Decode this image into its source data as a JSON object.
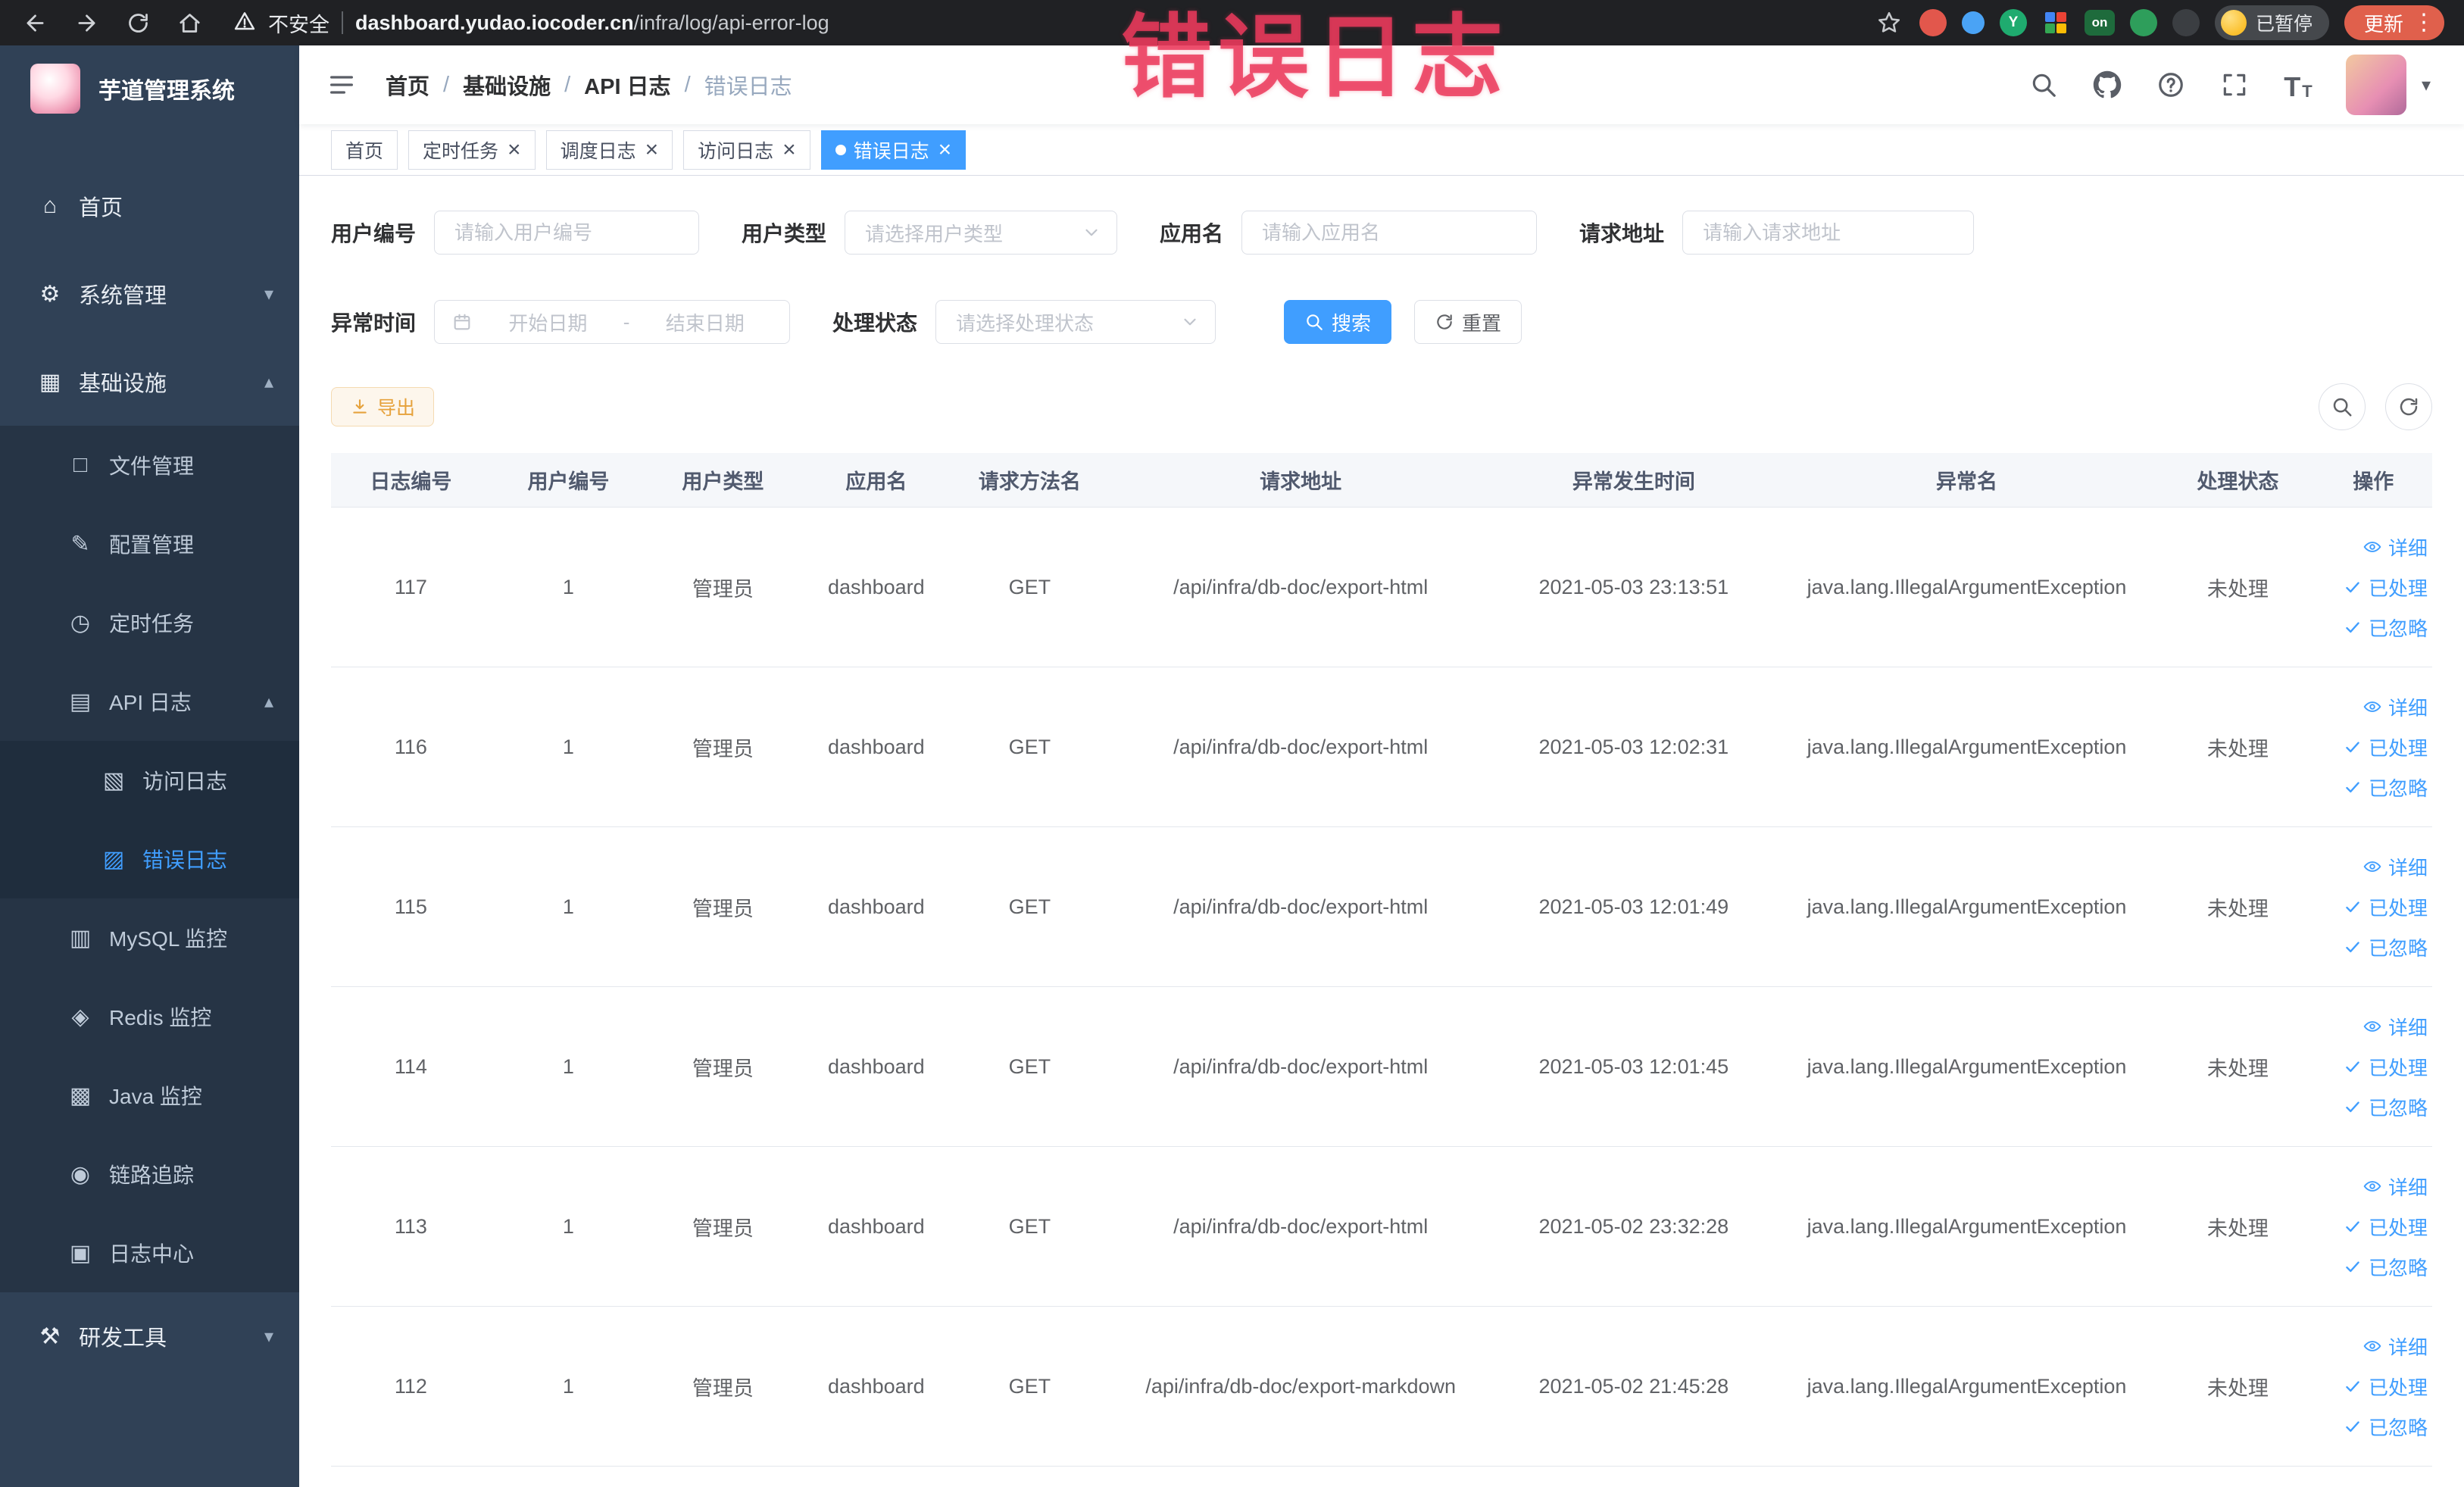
{
  "annotation": {
    "text": "错误日志"
  },
  "browser": {
    "security_label": "不安全",
    "url_host": "dashboard.yudao.iocoder.cn",
    "url_path": "/infra/log/api-error-log",
    "paused_badge": "已暂停",
    "update_button": "更新",
    "extension_on_badge": "on",
    "extension_y_badge": "Y"
  },
  "sidebar": {
    "logo_title": "芋道管理系统",
    "items": [
      {
        "name": "home",
        "label": "首页",
        "icon": "home-icon",
        "level": 0
      },
      {
        "name": "system-management",
        "label": "系统管理",
        "icon": "gear-icon",
        "level": 0,
        "arrow": "down"
      },
      {
        "name": "infrastructure",
        "label": "基础设施",
        "icon": "infra-icon",
        "level": 0,
        "arrow": "up"
      },
      {
        "name": "file-management",
        "label": "文件管理",
        "icon": "file-icon",
        "level": 1
      },
      {
        "name": "config-management",
        "label": "配置管理",
        "icon": "config-icon",
        "level": 1
      },
      {
        "name": "scheduled-tasks",
        "label": "定时任务",
        "icon": "schedule-icon",
        "level": 1
      },
      {
        "name": "api-log",
        "label": "API 日志",
        "icon": "api-log-icon",
        "level": 1,
        "arrow": "up"
      },
      {
        "name": "access-log",
        "label": "访问日志",
        "icon": "access-log-icon",
        "level": 2
      },
      {
        "name": "error-log",
        "label": "错误日志",
        "icon": "error-log-icon",
        "level": 2,
        "active": true
      },
      {
        "name": "mysql-monitor",
        "label": "MySQL 监控",
        "icon": "mysql-icon",
        "level": 1
      },
      {
        "name": "redis-monitor",
        "label": "Redis 监控",
        "icon": "redis-icon",
        "level": 1
      },
      {
        "name": "java-monitor",
        "label": "Java 监控",
        "icon": "java-icon",
        "level": 1
      },
      {
        "name": "trace",
        "label": "链路追踪",
        "icon": "trace-icon",
        "level": 1
      },
      {
        "name": "log-center",
        "label": "日志中心",
        "icon": "log-center-icon",
        "level": 1
      },
      {
        "name": "dev-tools",
        "label": "研发工具",
        "icon": "tools-icon",
        "level": 0,
        "arrow": "down"
      }
    ]
  },
  "navbar": {
    "breadcrumb": [
      "首页",
      "基础设施",
      "API 日志",
      "错误日志"
    ]
  },
  "tabs": [
    {
      "name": "home",
      "label": "首页",
      "closable": false,
      "active": false
    },
    {
      "name": "scheduled-tasks",
      "label": "定时任务",
      "closable": true,
      "active": false
    },
    {
      "name": "schedule-log",
      "label": "调度日志",
      "closable": true,
      "active": false
    },
    {
      "name": "access-log",
      "label": "访问日志",
      "closable": true,
      "active": false
    },
    {
      "name": "error-log",
      "label": "错误日志",
      "closable": true,
      "active": true
    }
  ],
  "filters": {
    "user_id_label": "用户编号",
    "user_id_placeholder": "请输入用户编号",
    "user_type_label": "用户类型",
    "user_type_placeholder": "请选择用户类型",
    "app_name_label": "应用名",
    "app_name_placeholder": "请输入应用名",
    "request_url_label": "请求地址",
    "request_url_placeholder": "请输入请求地址",
    "exception_time_label": "异常时间",
    "date_start_placeholder": "开始日期",
    "date_separator": "-",
    "date_end_placeholder": "结束日期",
    "process_status_label": "处理状态",
    "process_status_placeholder": "请选择处理状态",
    "search_button": "搜索",
    "reset_button": "重置"
  },
  "toolbar": {
    "export_button": "导出"
  },
  "table": {
    "columns": [
      "日志编号",
      "用户编号",
      "用户类型",
      "应用名",
      "请求方法名",
      "请求地址",
      "异常发生时间",
      "异常名",
      "处理状态",
      "操作"
    ],
    "actions": [
      "详细",
      "已处理",
      "已忽略"
    ],
    "rows": [
      {
        "id": "117",
        "user_id": "1",
        "user_type": "管理员",
        "app": "dashboard",
        "method": "GET",
        "url": "/api/infra/db-doc/export-html",
        "time": "2021-05-03 23:13:51",
        "exception": "java.lang.IllegalArgumentException",
        "status": "未处理"
      },
      {
        "id": "116",
        "user_id": "1",
        "user_type": "管理员",
        "app": "dashboard",
        "method": "GET",
        "url": "/api/infra/db-doc/export-html",
        "time": "2021-05-03 12:02:31",
        "exception": "java.lang.IllegalArgumentException",
        "status": "未处理"
      },
      {
        "id": "115",
        "user_id": "1",
        "user_type": "管理员",
        "app": "dashboard",
        "method": "GET",
        "url": "/api/infra/db-doc/export-html",
        "time": "2021-05-03 12:01:49",
        "exception": "java.lang.IllegalArgumentException",
        "status": "未处理"
      },
      {
        "id": "114",
        "user_id": "1",
        "user_type": "管理员",
        "app": "dashboard",
        "method": "GET",
        "url": "/api/infra/db-doc/export-html",
        "time": "2021-05-03 12:01:45",
        "exception": "java.lang.IllegalArgumentException",
        "status": "未处理"
      },
      {
        "id": "113",
        "user_id": "1",
        "user_type": "管理员",
        "app": "dashboard",
        "method": "GET",
        "url": "/api/infra/db-doc/export-html",
        "time": "2021-05-02 23:32:28",
        "exception": "java.lang.IllegalArgumentException",
        "status": "未处理"
      },
      {
        "id": "112",
        "user_id": "1",
        "user_type": "管理员",
        "app": "dashboard",
        "method": "GET",
        "url": "/api/infra/db-doc/export-markdown",
        "time": "2021-05-02 21:45:28",
        "exception": "java.lang.IllegalArgumentException",
        "status": "未处理"
      }
    ]
  },
  "colors": {
    "accent": "#409EFF",
    "warning": "#e6a23c",
    "annotation": "#eb3a5c",
    "sidebar_bg": "#304156"
  }
}
